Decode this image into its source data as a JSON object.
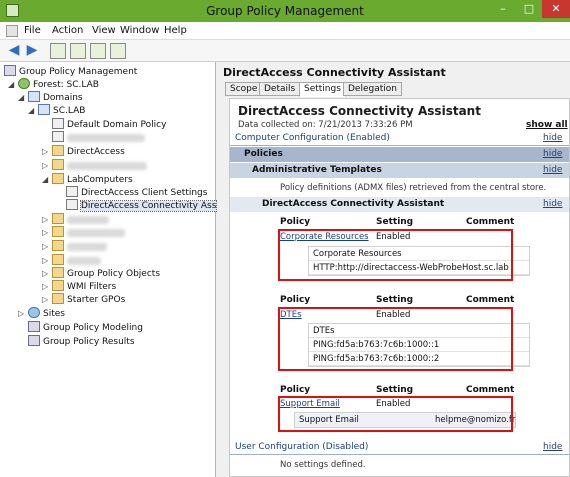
{
  "window": {
    "title": "Group Policy Management",
    "min": "–",
    "max": "□",
    "close": "✕"
  },
  "menu": [
    "File",
    "Action",
    "View",
    "Window",
    "Help"
  ],
  "tree": {
    "root": "Group Policy Management",
    "forest": "Forest: SC.LAB",
    "domains": "Domains",
    "domain": "SC.LAB",
    "default_policy": "Default Domain Policy",
    "directaccess": "DirectAccess",
    "labcomputers": "LabComputers",
    "da_client": "DirectAccess Client Settings",
    "da_assistant": "DirectAccess Connectivity Ass",
    "gpo_objects": "Group Policy Objects",
    "wmi": "WMI Filters",
    "starter": "Starter GPOs",
    "sites": "Sites",
    "modeling": "Group Policy Modeling",
    "results": "Group Policy Results"
  },
  "pane": {
    "title": "DirectAccess Connectivity Assistant",
    "tabs": [
      "Scope",
      "Details",
      "Settings",
      "Delegation"
    ],
    "active_tab": "Settings"
  },
  "report": {
    "title": "DirectAccess Connectivity Assistant",
    "collected": "Data collected on: 7/21/2013 7:33:26 PM",
    "show_all": "show all",
    "hide": "hide",
    "computer_config": "Computer Configuration (Enabled)",
    "policies": "Policies",
    "admin_templates": "Administrative Templates",
    "policy_defs": "Policy definitions (ADMX files) retrieved from the central store.",
    "section": "DirectAccess Connectivity Assistant",
    "col_policy": "Policy",
    "col_setting": "Setting",
    "col_comment": "Comment",
    "p1": {
      "name": "Corporate Resources",
      "setting": "Enabled",
      "sub_head": "Corporate Resources",
      "sub_1": "HTTP:http://directaccess-WebProbeHost.sc.lab"
    },
    "p2": {
      "name": "DTEs",
      "setting": "Enabled",
      "sub_head": "DTEs",
      "sub_1": "PING:fd5a:b763:7c6b:1000::1",
      "sub_2": "PING:fd5a:b763:7c6b:1000::2"
    },
    "p3": {
      "name": "Support Email",
      "setting": "Enabled",
      "sub_key": "Support Email",
      "sub_val": "helpme@nomizo.fr"
    },
    "user_config": "User Configuration (Disabled)",
    "no_settings": "No settings defined."
  },
  "colors": {
    "title_bar": "#6aaa2e",
    "highlight": "#dd1111",
    "policies_bar": "#a6b6cc"
  }
}
